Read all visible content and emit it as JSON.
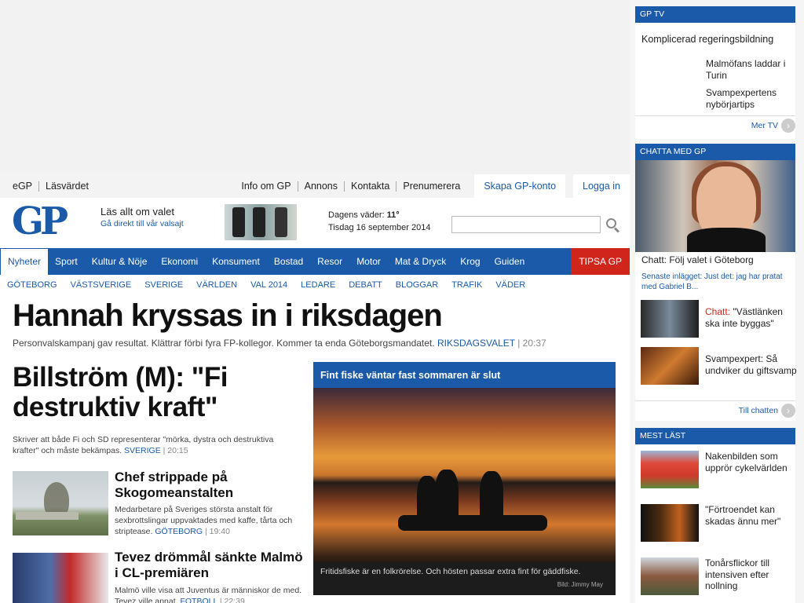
{
  "topbar": {
    "left_links": [
      "eGP",
      "Läsvärdet"
    ],
    "right_links": [
      "Info om GP",
      "Annons",
      "Kontakta",
      "Prenumerera"
    ],
    "create_account": "Skapa GP-konto",
    "login": "Logga in"
  },
  "header": {
    "logo": "GP",
    "valet_title": "Läs allt om valet",
    "valet_link": "Gå direkt till vår valsajt",
    "weather_label": "Dagens väder:",
    "weather_temp": "11°",
    "date": "Tisdag 16 september 2014",
    "search_placeholder": ""
  },
  "nav": {
    "items": [
      "Nyheter",
      "Sport",
      "Kultur & Nöje",
      "Ekonomi",
      "Konsument",
      "Bostad",
      "Resor",
      "Motor",
      "Mat & Dryck",
      "Krog",
      "Guiden"
    ],
    "tipsa": "TIPSA GP",
    "subitems": [
      "GÖTEBORG",
      "VÄSTSVERIGE",
      "SVERIGE",
      "VÄRLDEN",
      "VAL 2014",
      "LEDARE",
      "DEBATT",
      "BLOGGAR",
      "TRAFIK",
      "VÄDER"
    ]
  },
  "top_story": {
    "headline": "Hannah kryssas in i riksdagen",
    "summary": "Personvalskampanj gav resultat. Klättrar förbi fyra FP-kollegor. Kommer ta enda Göteborgsmandatet.",
    "tag": "RIKSDAGSVALET",
    "time": "| 20:37"
  },
  "story2": {
    "headline": "Billström (M): \"Fi destruktiv kraft\"",
    "summary": "Skriver att både Fi och SD representerar \"mörka, dystra och destruktiva krafter\" och måste bekämpas.",
    "tag": "SVERIGE",
    "time": "| 20:15"
  },
  "story3": {
    "headline": "Chef strippade på Skogomeanstalten",
    "summary": "Medarbetare på Sveriges största anstalt för sexbrottslingar uppvaktades med kaffe, tårta och striptease.",
    "tag": "GÖTEBORG",
    "time": "| 19:40"
  },
  "story4": {
    "headline": "Tevez drömmål sänkte Malmö i CL-premiären",
    "summary": "Malmö ville visa att Juventus är människor de med. Tevez ville annat.",
    "tag": "FOTBOLL",
    "time": "| 22:39"
  },
  "feature": {
    "title": "Fint fiske väntar fast sommaren är slut",
    "caption": "Fritidsfiske är en folkrörelse. Och hösten passar extra fint för gäddfiske.",
    "credit": "Bild: Jimmy May"
  },
  "gptv": {
    "heading": "GP TV",
    "item1": "Komplicerad regeringsbildning",
    "item2": "Malmöfans laddar i Turin",
    "item3": "Svampexpertens nybörjartips",
    "more": "Mer TV"
  },
  "chat": {
    "heading": "CHATTA MED GP",
    "title": "Chatt: Följ valet i Göteborg",
    "latest": "Senaste inlägget: Just det: jag har pratat med Gabriel B...",
    "item1_prefix": "Chatt:",
    "item1_text": " \"Västlänken ska inte byggas\"",
    "item2": "Svampexpert: Så undviker du giftsvamp",
    "more": "Till chatten"
  },
  "most_read": {
    "heading": "MEST LÄST",
    "items": [
      "Nakenbilden som upprör cykelvärlden",
      "\"Förtroendet kan skadas ännu mer\"",
      "Tonårsflickor till intensiven efter nollning"
    ]
  },
  "colors": {
    "brand_blue": "#1a5aa8",
    "tipsa_red": "#d0251b"
  }
}
